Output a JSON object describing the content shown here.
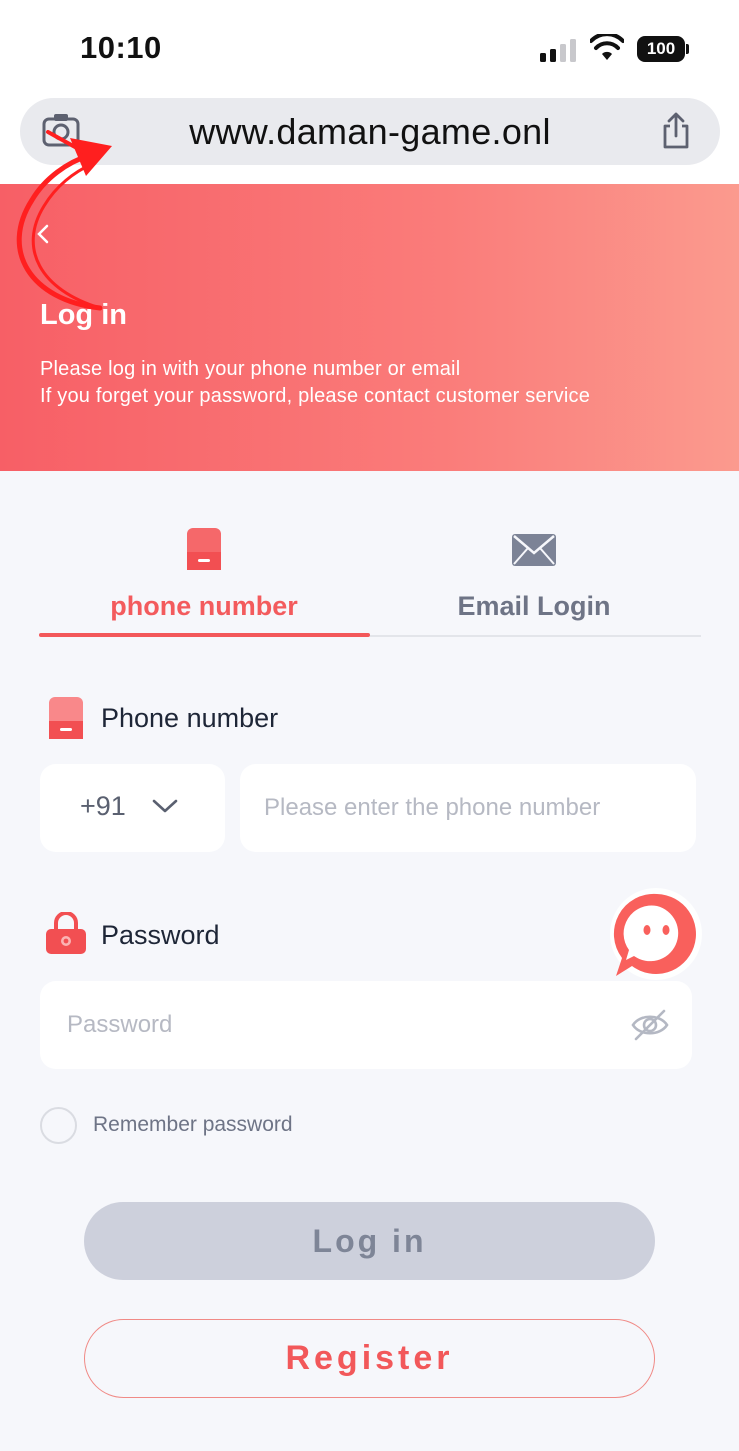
{
  "status_bar": {
    "time": "10:10",
    "battery": "100"
  },
  "browser": {
    "url": "www.daman-game.onl"
  },
  "hero": {
    "title": "Log in",
    "subtitle_line1": "Please log in with your phone number or email",
    "subtitle_line2": "If you forget your password, please contact customer service"
  },
  "tabs": [
    {
      "label": "phone number",
      "active": true
    },
    {
      "label": "Email Login",
      "active": false
    }
  ],
  "form": {
    "phone_label": "Phone number",
    "country_code": "+91",
    "phone_placeholder": "Please enter the phone number",
    "password_label": "Password",
    "password_placeholder": "Password",
    "remember_label": "Remember password",
    "login_button": "Log in",
    "register_button": "Register"
  },
  "colors": {
    "accent": "#f3585a",
    "hero_gradient_start": "#f75f66",
    "hero_gradient_end": "#fb9a8e",
    "page_bg": "#f6f7fb",
    "disabled_button": "#cdd0dc"
  },
  "icons": {
    "url_bar_left": "camera-icon",
    "url_bar_right": "share-icon",
    "hero_back": "back-arrow-icon",
    "tab_phone": "phone-icon",
    "tab_email": "envelope-icon",
    "password_label": "lock-icon",
    "password_toggle": "eye-off-icon",
    "chat": "chat-bubble-icon",
    "annotation": "curved-arrow-icon"
  }
}
